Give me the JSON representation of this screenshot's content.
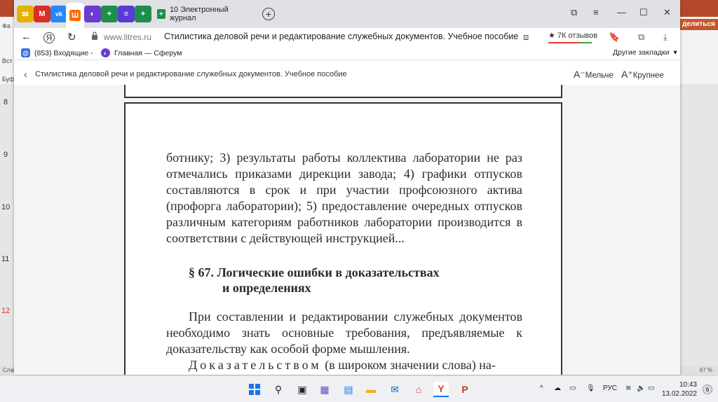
{
  "browser": {
    "tabs": [
      {
        "name": "mail",
        "color": "#e2b400",
        "glyph": "✉"
      },
      {
        "name": "gmail",
        "color": "#d93025",
        "glyph": "M"
      },
      {
        "name": "vk",
        "color": "#2787f5",
        "glyph": "vk"
      },
      {
        "name": "litres",
        "color": "#ff6b00",
        "glyph": "Ш"
      },
      {
        "name": "sferum",
        "color": "#6a3ccf",
        "glyph": "◐"
      },
      {
        "name": "dnevnik",
        "color": "#1f8e4b",
        "glyph": "+"
      },
      {
        "name": "list",
        "color": "#5b3bd6",
        "glyph": "≡"
      },
      {
        "name": "dnevnik-2",
        "color": "#1f8e4b",
        "glyph": "+"
      }
    ],
    "active_tab_title": "10 Электронный журнал",
    "url_host": "www.litres.ru",
    "url_title": "Стилистика деловой речи и редактирование служебных документов. Учебное пособие",
    "reviews": "★ 7К отзывов",
    "bookmarks": [
      {
        "label": "(853) Входящие -",
        "icon": "mail-icon",
        "color": "#3a6fd8"
      },
      {
        "label": "Главная — Сферум",
        "icon": "sferum-icon",
        "color": "#6a3ccf"
      }
    ],
    "other_bookmarks": "Другие закладки",
    "reader": {
      "title": "Стилистика деловой речи и редактирование служебных документов. Учебное пособие",
      "smaller": "Мельче",
      "bigger": "Крупнее"
    }
  },
  "book": {
    "paragraph1": "ботнику; 3) результаты работы коллектива лаборатории не раз отмечались приказами дирекции завода; 4) графики отпусков составляются в срок и при участии профсоюзного актива (профорга лаборатории); 5) предоставление очередных отпусков различным категориям работников лаборатории производится в соответствии с действующей инструкцией...",
    "heading_line1": "§ 67. Логические ошибки в доказательствах",
    "heading_line2": "и определениях",
    "paragraph2": "При составлении и редактировании служебных документов необходимо знать основные требования, предъявляемые к доказательству как особой форме мышления.",
    "paragraph3_spaced": "Доказательством",
    "paragraph3_rest": " (в широком значении слова) на-"
  },
  "powerpoint": {
    "share": "делиться",
    "ruler": [
      "8",
      "9",
      "10",
      "11",
      "12"
    ],
    "ribbon_labels": [
      "Фа",
      "Вст",
      "Буф"
    ],
    "status_left": "Слайд",
    "zoom": "67 %"
  },
  "taskbar": {
    "lang": "РУС",
    "time": "10:43",
    "date": "13.02.2022",
    "notifications": "6"
  }
}
